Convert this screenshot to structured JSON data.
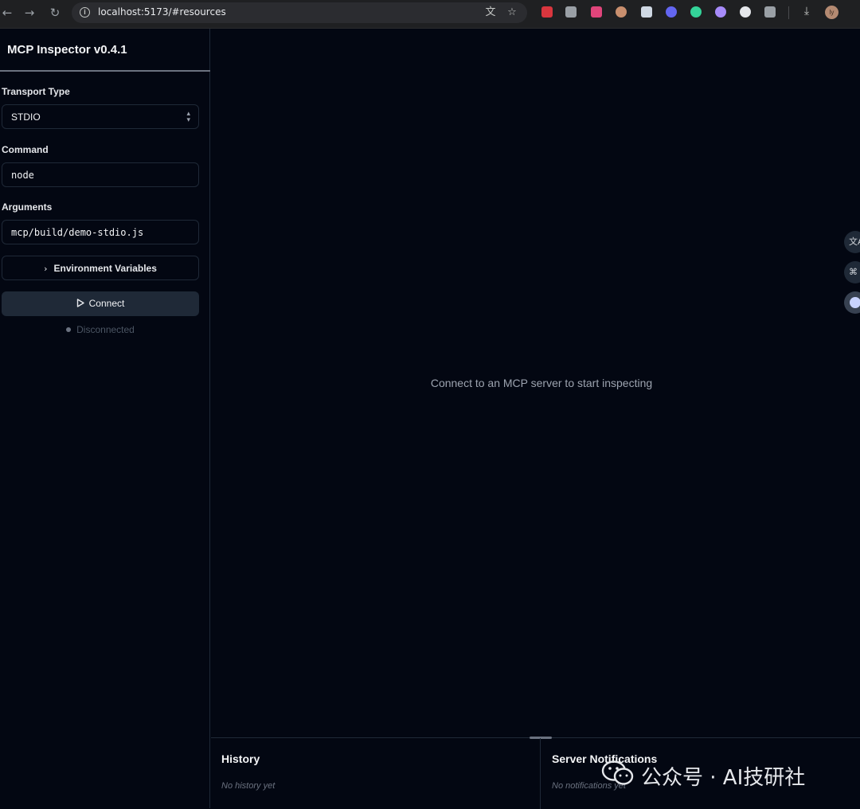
{
  "browser": {
    "url": "localhost:5173/#resources",
    "back_glyph": "←",
    "forward_glyph": "→",
    "reload_glyph": "↻",
    "star_glyph": "☆",
    "translate_glyph": "文",
    "download_glyph": "⤓",
    "profile_initials": "ly",
    "extension_colors": [
      "#d9363e",
      "#9aa0a6",
      "#e0457b",
      "#c98f6e",
      "#cfd8e3",
      "#6366f1",
      "#34d399",
      "#a78bfa",
      "#e5e7eb",
      "#9aa0a6"
    ]
  },
  "sidebar": {
    "title": "MCP Inspector v0.4.1",
    "transport": {
      "label": "Transport Type",
      "value": "STDIO",
      "chevron": "⌃⌄"
    },
    "command": {
      "label": "Command",
      "value": "node"
    },
    "arguments": {
      "label": "Arguments",
      "value": "mcp/build/demo-stdio.js"
    },
    "env": {
      "label": "Environment Variables",
      "chevron": "›"
    },
    "connect": {
      "label": "Connect"
    },
    "status": {
      "text": "Disconnected",
      "color": "#6b7280"
    }
  },
  "main": {
    "empty_message": "Connect to an MCP server to start inspecting",
    "floating": {
      "translate_glyph": "文A",
      "grid_glyph": "⌘"
    }
  },
  "bottom": {
    "history": {
      "title": "History",
      "empty": "No history yet"
    },
    "notifications": {
      "title": "Server Notifications",
      "empty": "No notifications yet"
    }
  },
  "watermark": {
    "text": "公众号 · AI技研社"
  },
  "colors": {
    "background": "#030712",
    "border": "#1f2937",
    "button_bg": "#1f2937",
    "muted_text": "#9ca3af"
  }
}
